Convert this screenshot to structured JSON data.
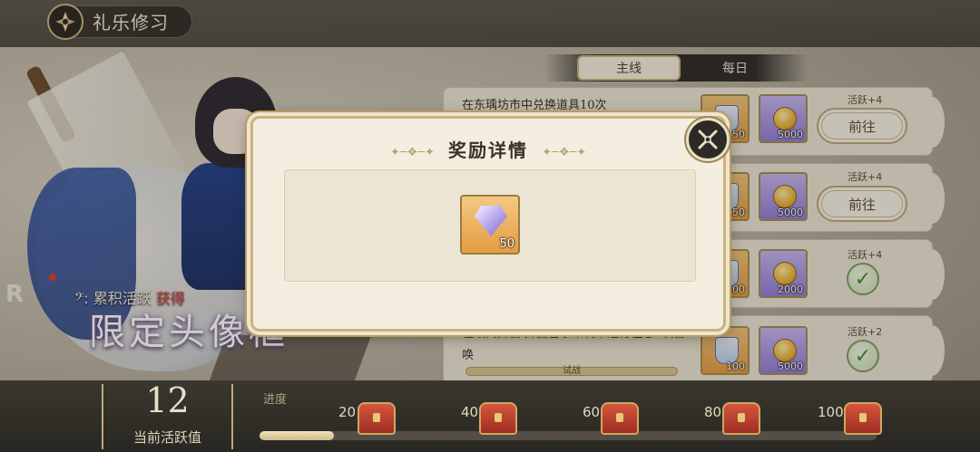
{
  "header": {
    "title": "礼乐修习"
  },
  "promo": {
    "r_letter": "R",
    "accumulate_prefix": "累积活跃",
    "accumulate_highlight": "获得",
    "big_text": "限定头像框"
  },
  "tabs": [
    {
      "label": "主线",
      "active": true
    },
    {
      "label": "每日",
      "active": false
    }
  ],
  "tasks": [
    {
      "title": "在东瑀坊市中兑换道具10次",
      "rewards": [
        {
          "type": "cup",
          "count": "150"
        },
        {
          "type": "coin",
          "count": "5000"
        }
      ],
      "active": "活跃+4",
      "action": "前往"
    },
    {
      "title": "",
      "rewards": [
        {
          "type": "cup",
          "count": "150"
        },
        {
          "type": "coin",
          "count": "5000"
        }
      ],
      "active": "活跃+4",
      "action": "前往"
    },
    {
      "title": "",
      "rewards": [
        {
          "type": "cup",
          "count": "500"
        },
        {
          "type": "coin",
          "count": "2000"
        }
      ],
      "active": "活跃+4",
      "action": "done"
    },
    {
      "title": "在纸间舞剧·异曲音乐米调中进行往思5次召",
      "title2": "唤",
      "bar_text": "试战",
      "rewards": [
        {
          "type": "cup",
          "count": "100"
        },
        {
          "type": "coin",
          "count": "5000"
        }
      ],
      "active": "活跃+2",
      "action": "done"
    }
  ],
  "bottom": {
    "active_value": "12",
    "active_caption": "当前活跃值",
    "progress_label": "进度",
    "progress_fraction": 0.12,
    "milestones": [
      "20",
      "40",
      "60",
      "80",
      "100"
    ]
  },
  "modal": {
    "title": "奖励详情",
    "reward_count": "50",
    "ornament": "✦─❖─✦"
  },
  "colors": {
    "accent_gold": "#c9b27a",
    "reward_highlight": "#e04a3a",
    "check_green": "#3f8a2a"
  },
  "icons": {
    "header": "lotus-emblem-icon",
    "close": "close-x-icon",
    "reward": "purple-gem-icon",
    "milestone": "treasure-chest-icon",
    "done": "check-icon"
  }
}
